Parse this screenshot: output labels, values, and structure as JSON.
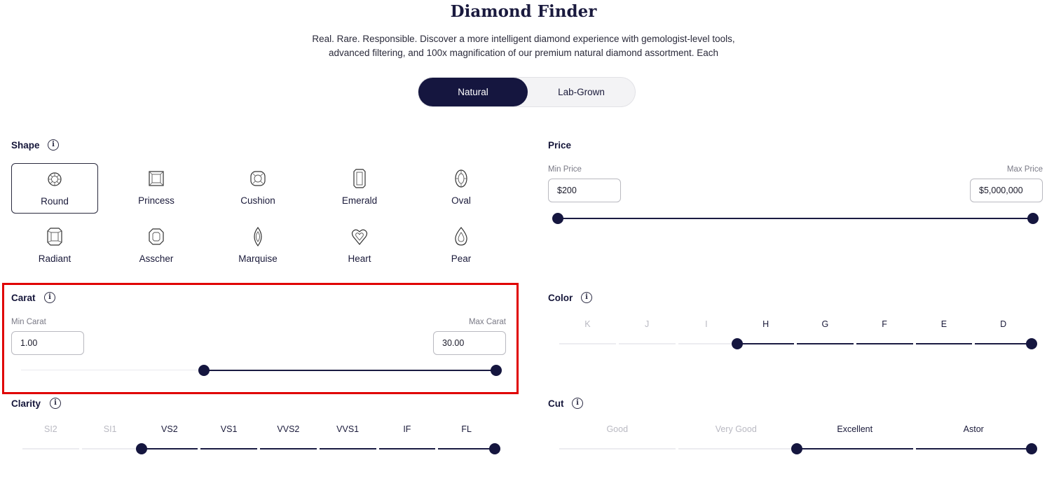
{
  "header": {
    "title": "Diamond Finder",
    "subtitle_line1": "Real. Rare. Responsible. Discover a more intelligent diamond experience with gemologist-level tools,",
    "subtitle_line2": "advanced filtering, and 100x magnification of our premium natural diamond assortment. Each"
  },
  "type_toggle": {
    "options": [
      "Natural",
      "Lab-Grown"
    ],
    "selected": "Natural"
  },
  "shape": {
    "title": "Shape",
    "selected": "Round",
    "items": [
      {
        "label": "Round",
        "icon": "round-diamond-icon"
      },
      {
        "label": "Princess",
        "icon": "princess-diamond-icon"
      },
      {
        "label": "Cushion",
        "icon": "cushion-diamond-icon"
      },
      {
        "label": "Emerald",
        "icon": "emerald-diamond-icon"
      },
      {
        "label": "Oval",
        "icon": "oval-diamond-icon"
      },
      {
        "label": "Radiant",
        "icon": "radiant-diamond-icon"
      },
      {
        "label": "Asscher",
        "icon": "asscher-diamond-icon"
      },
      {
        "label": "Marquise",
        "icon": "marquise-diamond-icon"
      },
      {
        "label": "Heart",
        "icon": "heart-diamond-icon"
      },
      {
        "label": "Pear",
        "icon": "pear-diamond-icon"
      }
    ]
  },
  "price": {
    "title": "Price",
    "min_label": "Min Price",
    "max_label": "Max Price",
    "min_value": "$200",
    "max_value": "$5,000,000",
    "slider_range": [
      0,
      1
    ]
  },
  "carat": {
    "title": "Carat",
    "min_label": "Min Carat",
    "max_label": "Max Carat",
    "min_value": "1.00",
    "max_value": "30.00",
    "slider_range": [
      0.38,
      1
    ]
  },
  "color": {
    "title": "Color",
    "grades": [
      "K",
      "J",
      "I",
      "H",
      "G",
      "F",
      "E",
      "D"
    ],
    "selected_from": "H",
    "selected_to": "D"
  },
  "clarity": {
    "title": "Clarity",
    "grades": [
      "SI2",
      "SI1",
      "VS2",
      "VS1",
      "VVS2",
      "VVS1",
      "IF",
      "FL"
    ],
    "selected_from": "VS2",
    "selected_to": "FL"
  },
  "cut": {
    "title": "Cut",
    "grades": [
      "Good",
      "Very Good",
      "Excellent",
      "Astor"
    ],
    "selected_from": "Excellent",
    "selected_to": "Astor"
  },
  "theme": {
    "accent": "#15163f",
    "highlight": "#e00000"
  }
}
